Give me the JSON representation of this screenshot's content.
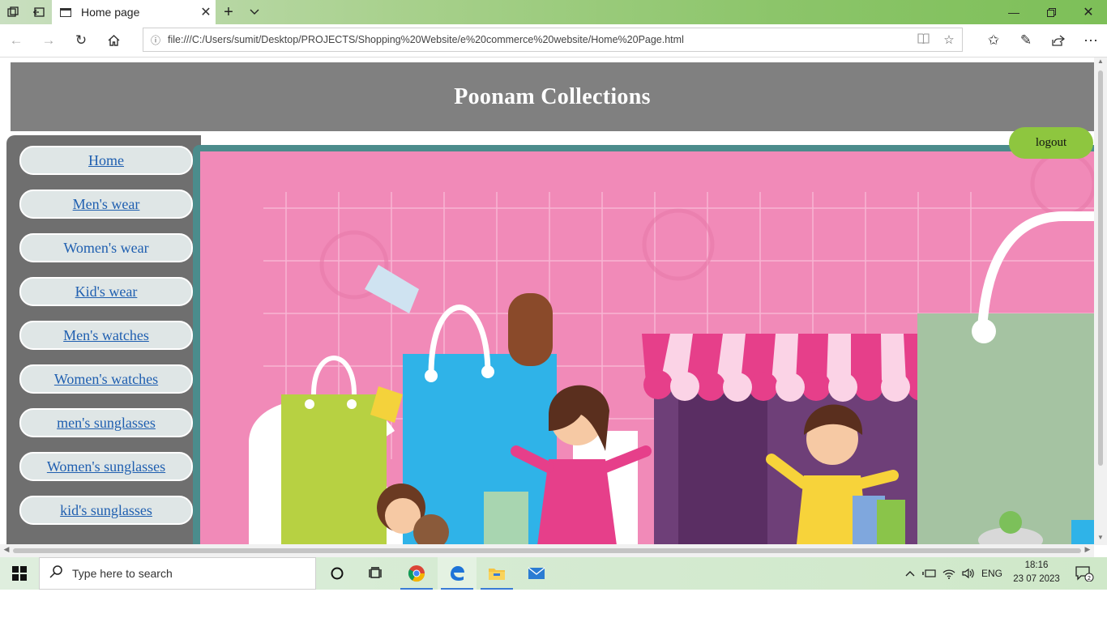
{
  "browser": {
    "tab_title": "Home page",
    "url": "file:///C:/Users/sumit/Desktop/PROJECTS/Shopping%20Website/e%20commerce%20website/Home%20Page.html"
  },
  "site": {
    "title": "Poonam Collections",
    "logout_label": "logout",
    "accent_colors": {
      "header": "#808080",
      "sidebar": "#6f6f6f",
      "logout": "#8ec63f",
      "banner": "#f18ab8",
      "link": "#1f5fb0"
    }
  },
  "sidebar": {
    "items": [
      {
        "label": "Home"
      },
      {
        "label": "Men's wear"
      },
      {
        "label": "Women's wear"
      },
      {
        "label": "Kid's wear"
      },
      {
        "label": "Men's watches"
      },
      {
        "label": "Women's watches"
      },
      {
        "label": "men's sunglasses"
      },
      {
        "label": "Women's sunglasses"
      },
      {
        "label": "kid's sunglasses"
      }
    ]
  },
  "taskbar": {
    "search_placeholder": "Type here to search",
    "language": "ENG",
    "time": "18:16",
    "date": "23 07 2023",
    "notification_count": "2"
  }
}
